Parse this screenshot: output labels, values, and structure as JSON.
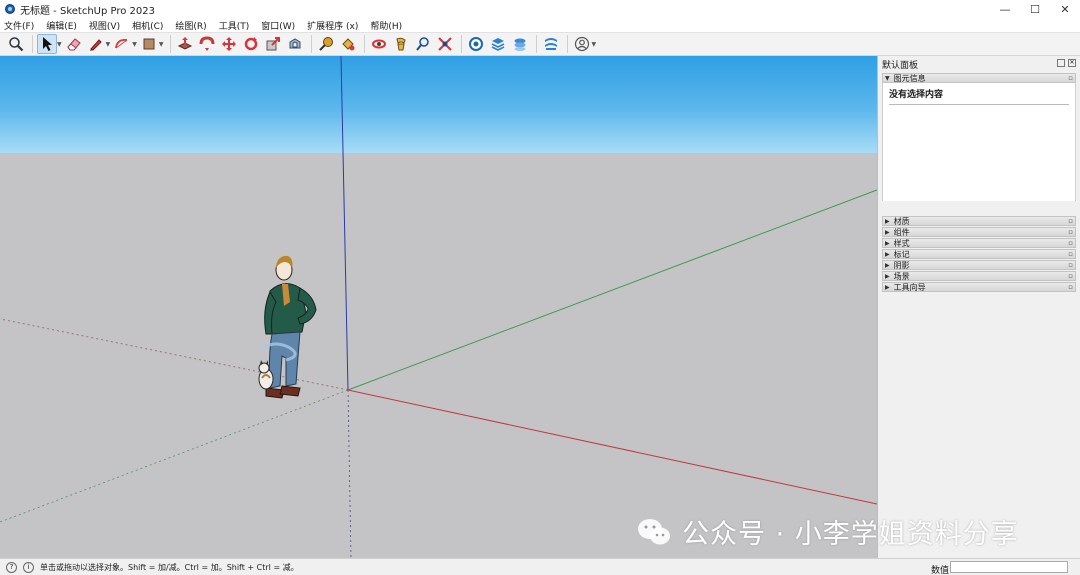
{
  "window": {
    "title": "无标题 - SketchUp Pro 2023",
    "controls": {
      "minimize": "—",
      "maximize": "☐",
      "close": "✕"
    }
  },
  "menu": [
    "文件(F)",
    "编辑(E)",
    "视图(V)",
    "相机(C)",
    "绘图(R)",
    "工具(T)",
    "窗口(W)",
    "扩展程序 (x)",
    "帮助(H)"
  ],
  "toolbar": {
    "tools": [
      "zoom-icon",
      "select-icon",
      "eraser-icon",
      "pencil-icon",
      "arc-icon",
      "shape-icon",
      "push-pull-icon",
      "follow-me-icon",
      "move-icon",
      "rotate-icon",
      "scale-icon",
      "offset-icon",
      "tape-measure-icon",
      "paint-bucket-icon",
      "orbit-icon",
      "walk-icon",
      "zoom-window-icon",
      "zoom-extents-icon",
      "warehouse-icon",
      "extension-warehouse-icon",
      "layout-icon",
      "styles-icon",
      "account-icon"
    ]
  },
  "tray": {
    "title": "默认面板",
    "entity_info": {
      "label": "图元信息",
      "body": "没有选择内容"
    },
    "panels": [
      "材质",
      "组件",
      "样式",
      "标记",
      "阴影",
      "场景",
      "工具向导"
    ]
  },
  "status": {
    "hint": "单击或拖动以选择对象。Shift = 加/减。Ctrl = 加。Shift + Ctrl = 减。",
    "measure_label": "数值",
    "measure_value": ""
  },
  "watermark": "公众号 · 小李学姐资料分享",
  "colors": {
    "sky_top": "#2f9fe4",
    "ground": "#c4c4c6",
    "axis_red": "#c0393f",
    "axis_green": "#3c9a4a",
    "axis_blue": "#2b3aa8"
  }
}
